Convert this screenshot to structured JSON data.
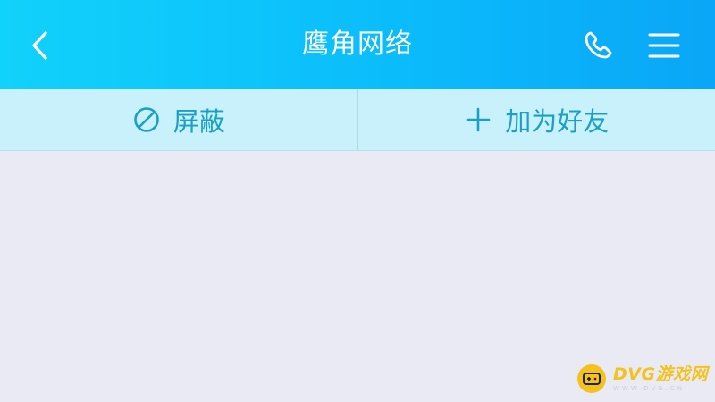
{
  "header": {
    "title": "鹰角网络",
    "back_icon": "chevron-left-icon",
    "phone_icon": "phone-icon",
    "menu_icon": "hamburger-menu-icon"
  },
  "actions": {
    "block": {
      "label": "屏蔽",
      "icon": "block-icon"
    },
    "add_friend": {
      "label": "加为好友",
      "icon": "plus-icon"
    }
  },
  "watermark": {
    "brand": "DVG游戏网",
    "url": "WWW.DVG.CN"
  },
  "colors": {
    "header_start": "#11d2fb",
    "header_end": "#0aa6f7",
    "action_bar": "#c8f1fb",
    "action_text": "#1aa0c8",
    "background": "#e9eaf4",
    "watermark": "#f4c21f"
  }
}
